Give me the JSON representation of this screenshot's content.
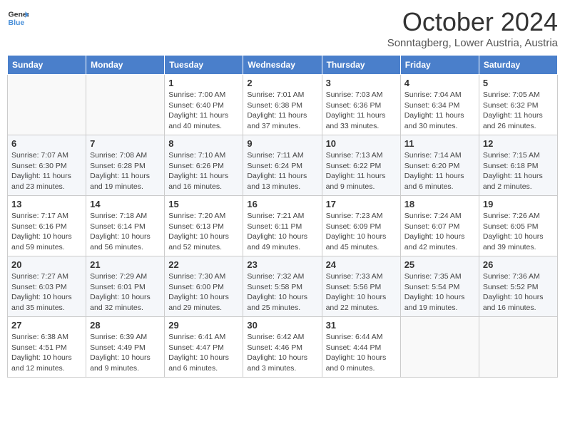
{
  "header": {
    "logo_general": "General",
    "logo_blue": "Blue",
    "month": "October 2024",
    "location": "Sonntagberg, Lower Austria, Austria"
  },
  "weekdays": [
    "Sunday",
    "Monday",
    "Tuesday",
    "Wednesday",
    "Thursday",
    "Friday",
    "Saturday"
  ],
  "weeks": [
    [
      {
        "day": "",
        "info": ""
      },
      {
        "day": "",
        "info": ""
      },
      {
        "day": "1",
        "info": "Sunrise: 7:00 AM\nSunset: 6:40 PM\nDaylight: 11 hours and 40 minutes."
      },
      {
        "day": "2",
        "info": "Sunrise: 7:01 AM\nSunset: 6:38 PM\nDaylight: 11 hours and 37 minutes."
      },
      {
        "day": "3",
        "info": "Sunrise: 7:03 AM\nSunset: 6:36 PM\nDaylight: 11 hours and 33 minutes."
      },
      {
        "day": "4",
        "info": "Sunrise: 7:04 AM\nSunset: 6:34 PM\nDaylight: 11 hours and 30 minutes."
      },
      {
        "day": "5",
        "info": "Sunrise: 7:05 AM\nSunset: 6:32 PM\nDaylight: 11 hours and 26 minutes."
      }
    ],
    [
      {
        "day": "6",
        "info": "Sunrise: 7:07 AM\nSunset: 6:30 PM\nDaylight: 11 hours and 23 minutes."
      },
      {
        "day": "7",
        "info": "Sunrise: 7:08 AM\nSunset: 6:28 PM\nDaylight: 11 hours and 19 minutes."
      },
      {
        "day": "8",
        "info": "Sunrise: 7:10 AM\nSunset: 6:26 PM\nDaylight: 11 hours and 16 minutes."
      },
      {
        "day": "9",
        "info": "Sunrise: 7:11 AM\nSunset: 6:24 PM\nDaylight: 11 hours and 13 minutes."
      },
      {
        "day": "10",
        "info": "Sunrise: 7:13 AM\nSunset: 6:22 PM\nDaylight: 11 hours and 9 minutes."
      },
      {
        "day": "11",
        "info": "Sunrise: 7:14 AM\nSunset: 6:20 PM\nDaylight: 11 hours and 6 minutes."
      },
      {
        "day": "12",
        "info": "Sunrise: 7:15 AM\nSunset: 6:18 PM\nDaylight: 11 hours and 2 minutes."
      }
    ],
    [
      {
        "day": "13",
        "info": "Sunrise: 7:17 AM\nSunset: 6:16 PM\nDaylight: 10 hours and 59 minutes."
      },
      {
        "day": "14",
        "info": "Sunrise: 7:18 AM\nSunset: 6:14 PM\nDaylight: 10 hours and 56 minutes."
      },
      {
        "day": "15",
        "info": "Sunrise: 7:20 AM\nSunset: 6:13 PM\nDaylight: 10 hours and 52 minutes."
      },
      {
        "day": "16",
        "info": "Sunrise: 7:21 AM\nSunset: 6:11 PM\nDaylight: 10 hours and 49 minutes."
      },
      {
        "day": "17",
        "info": "Sunrise: 7:23 AM\nSunset: 6:09 PM\nDaylight: 10 hours and 45 minutes."
      },
      {
        "day": "18",
        "info": "Sunrise: 7:24 AM\nSunset: 6:07 PM\nDaylight: 10 hours and 42 minutes."
      },
      {
        "day": "19",
        "info": "Sunrise: 7:26 AM\nSunset: 6:05 PM\nDaylight: 10 hours and 39 minutes."
      }
    ],
    [
      {
        "day": "20",
        "info": "Sunrise: 7:27 AM\nSunset: 6:03 PM\nDaylight: 10 hours and 35 minutes."
      },
      {
        "day": "21",
        "info": "Sunrise: 7:29 AM\nSunset: 6:01 PM\nDaylight: 10 hours and 32 minutes."
      },
      {
        "day": "22",
        "info": "Sunrise: 7:30 AM\nSunset: 6:00 PM\nDaylight: 10 hours and 29 minutes."
      },
      {
        "day": "23",
        "info": "Sunrise: 7:32 AM\nSunset: 5:58 PM\nDaylight: 10 hours and 25 minutes."
      },
      {
        "day": "24",
        "info": "Sunrise: 7:33 AM\nSunset: 5:56 PM\nDaylight: 10 hours and 22 minutes."
      },
      {
        "day": "25",
        "info": "Sunrise: 7:35 AM\nSunset: 5:54 PM\nDaylight: 10 hours and 19 minutes."
      },
      {
        "day": "26",
        "info": "Sunrise: 7:36 AM\nSunset: 5:52 PM\nDaylight: 10 hours and 16 minutes."
      }
    ],
    [
      {
        "day": "27",
        "info": "Sunrise: 6:38 AM\nSunset: 4:51 PM\nDaylight: 10 hours and 12 minutes."
      },
      {
        "day": "28",
        "info": "Sunrise: 6:39 AM\nSunset: 4:49 PM\nDaylight: 10 hours and 9 minutes."
      },
      {
        "day": "29",
        "info": "Sunrise: 6:41 AM\nSunset: 4:47 PM\nDaylight: 10 hours and 6 minutes."
      },
      {
        "day": "30",
        "info": "Sunrise: 6:42 AM\nSunset: 4:46 PM\nDaylight: 10 hours and 3 minutes."
      },
      {
        "day": "31",
        "info": "Sunrise: 6:44 AM\nSunset: 4:44 PM\nDaylight: 10 hours and 0 minutes."
      },
      {
        "day": "",
        "info": ""
      },
      {
        "day": "",
        "info": ""
      }
    ]
  ]
}
